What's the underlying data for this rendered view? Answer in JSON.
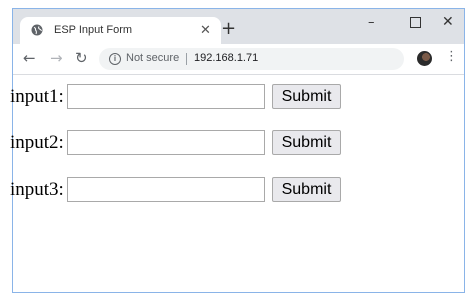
{
  "tab": {
    "title": "ESP Input Form",
    "close": "✕"
  },
  "new_tab": "+",
  "window_controls": {
    "minimize": "–",
    "maximize": "",
    "close": "✕"
  },
  "toolbar": {
    "back": "←",
    "forward": "→",
    "reload": "↻",
    "menu": "⋮"
  },
  "address_bar": {
    "security_text": "Not secure",
    "url": "192.168.1.71",
    "info_icon": "i"
  },
  "form": {
    "rows": [
      {
        "label": "input1:",
        "value": "",
        "button": "Submit"
      },
      {
        "label": "input2:",
        "value": "",
        "button": "Submit"
      },
      {
        "label": "input3:",
        "value": "",
        "button": "Submit"
      }
    ]
  }
}
